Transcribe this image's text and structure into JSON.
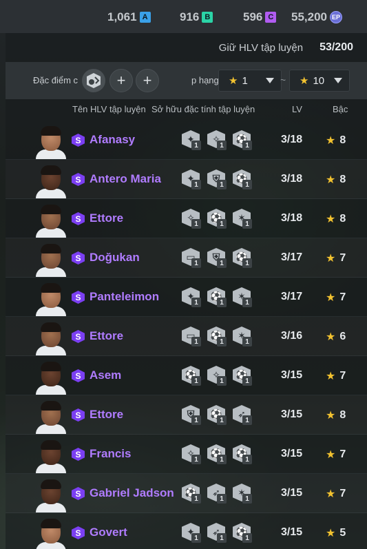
{
  "currencies": [
    {
      "value": "1,061",
      "badge": "A",
      "color": "#3aa0e8"
    },
    {
      "value": "916",
      "badge": "B",
      "color": "#2bd3a6"
    },
    {
      "value": "596",
      "badge": "C",
      "color": "#b15cf0"
    },
    {
      "value": "55,200",
      "badge": "EP",
      "color": "#6a6fd6"
    }
  ],
  "keep": {
    "label": "Giữ HLV tập luyện",
    "value": "53/200"
  },
  "filter": {
    "traits_label": "Đặc điểm c",
    "rank_label": "p hạng",
    "add_symbol": "+",
    "min": "1",
    "max": "10",
    "tilde": "~"
  },
  "header": {
    "name": "Tên HLV tập luyện",
    "traits": "Sở hữu đặc tính tập luyện",
    "lv": "LV",
    "rank": "Bậc"
  },
  "rows": [
    {
      "name": "Afanasy",
      "lv": "3/18",
      "rank": "8",
      "tone": "light",
      "traits": [
        {
          "icon": "✦",
          "n": "1"
        },
        {
          "icon": "✧",
          "n": "1"
        },
        {
          "icon": "⚽",
          "n": "1"
        }
      ]
    },
    {
      "name": "Antero Maria",
      "lv": "3/18",
      "rank": "8",
      "tone": "dark",
      "traits": [
        {
          "icon": "✦",
          "n": "1"
        },
        {
          "icon": "⛨",
          "n": "1"
        },
        {
          "icon": "⚽",
          "n": "1"
        }
      ]
    },
    {
      "name": "Ettore",
      "lv": "3/18",
      "rank": "8",
      "tone": "mid",
      "traits": [
        {
          "icon": "✧",
          "n": "1"
        },
        {
          "icon": "⚽",
          "n": "1"
        },
        {
          "icon": "✶",
          "n": "1"
        }
      ]
    },
    {
      "name": "Doğukan",
      "lv": "3/17",
      "rank": "7",
      "tone": "mid",
      "traits": [
        {
          "icon": "▭",
          "n": "1"
        },
        {
          "icon": "⛨",
          "n": "1"
        },
        {
          "icon": "⚽",
          "n": "1"
        }
      ]
    },
    {
      "name": "Panteleimon",
      "lv": "3/17",
      "rank": "7",
      "tone": "light",
      "traits": [
        {
          "icon": "✦",
          "n": "1"
        },
        {
          "icon": "⚽",
          "n": "1"
        },
        {
          "icon": "✶",
          "n": "1"
        }
      ]
    },
    {
      "name": "Ettore",
      "lv": "3/16",
      "rank": "6",
      "tone": "mid",
      "traits": [
        {
          "icon": "▭",
          "n": "1"
        },
        {
          "icon": "⚽",
          "n": "1"
        },
        {
          "icon": "✶",
          "n": "1"
        }
      ]
    },
    {
      "name": "Asem",
      "lv": "3/15",
      "rank": "7",
      "tone": "dark",
      "traits": [
        {
          "icon": "⚽",
          "n": "1"
        },
        {
          "icon": "✧",
          "n": "1"
        },
        {
          "icon": "⚽",
          "n": "1"
        }
      ]
    },
    {
      "name": "Ettore",
      "lv": "3/15",
      "rank": "8",
      "tone": "mid",
      "traits": [
        {
          "icon": "⛨",
          "n": "1"
        },
        {
          "icon": "⚽",
          "n": "1"
        },
        {
          "icon": "➶",
          "n": "1"
        }
      ]
    },
    {
      "name": "Francis",
      "lv": "3/15",
      "rank": "7",
      "tone": "dark",
      "traits": [
        {
          "icon": "✧",
          "n": "1"
        },
        {
          "icon": "⚽",
          "n": "1"
        },
        {
          "icon": "⚽",
          "n": "1"
        }
      ]
    },
    {
      "name": "Gabriel Jadson",
      "lv": "3/15",
      "rank": "7",
      "tone": "dark",
      "traits": [
        {
          "icon": "⚽",
          "n": "1"
        },
        {
          "icon": "➶",
          "n": "1"
        },
        {
          "icon": "✶",
          "n": "1"
        }
      ]
    },
    {
      "name": "Govert",
      "lv": "3/15",
      "rank": "5",
      "tone": "light",
      "traits": [
        {
          "icon": "✦",
          "n": "1"
        },
        {
          "icon": "➶",
          "n": "1"
        },
        {
          "icon": "⚽",
          "n": "1"
        }
      ]
    }
  ]
}
